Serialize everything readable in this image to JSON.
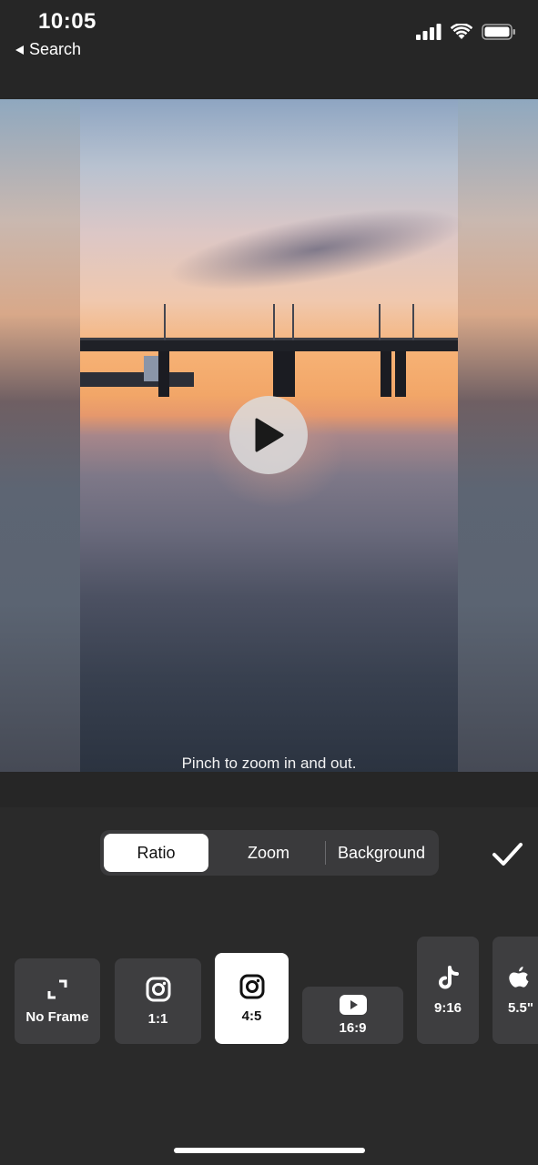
{
  "status_bar": {
    "time": "10:05",
    "back_label": "Search",
    "icons": [
      "signal-icon",
      "wifi-icon",
      "battery-icon"
    ]
  },
  "preview": {
    "hint": "Pinch to zoom in and out.",
    "play_icon": "play-icon"
  },
  "tabs": [
    {
      "label": "Ratio",
      "active": true
    },
    {
      "label": "Zoom",
      "active": false
    },
    {
      "label": "Background",
      "active": false
    }
  ],
  "confirm_icon": "checkmark-icon",
  "ratios": [
    {
      "label": "No Frame",
      "icon": "expand-frame-icon",
      "selected": false
    },
    {
      "label": "1:1",
      "icon": "instagram-icon",
      "selected": false
    },
    {
      "label": "4:5",
      "icon": "instagram-icon",
      "selected": true
    },
    {
      "label": "16:9",
      "icon": "youtube-icon",
      "selected": false
    },
    {
      "label": "9:16",
      "icon": "tiktok-icon",
      "selected": false
    },
    {
      "label": "5.5\"",
      "icon": "apple-icon",
      "selected": false
    }
  ],
  "colors": {
    "background": "#262626",
    "tile": "#3e3e40",
    "selected_tile": "#ffffff"
  }
}
